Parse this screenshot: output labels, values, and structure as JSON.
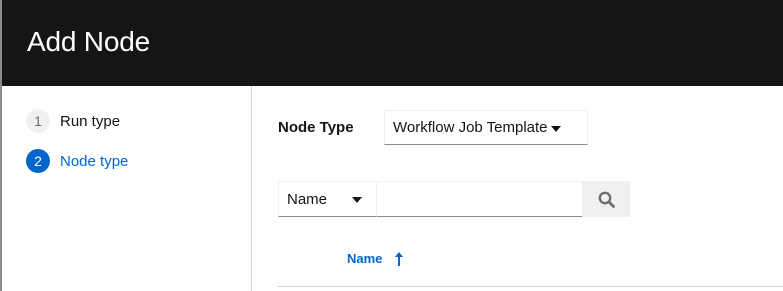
{
  "header": {
    "title": "Add Node"
  },
  "wizard": {
    "steps": [
      {
        "number": "1",
        "label": "Run type",
        "state": "inactive"
      },
      {
        "number": "2",
        "label": "Node type",
        "state": "active"
      }
    ]
  },
  "form": {
    "node_type_label": "Node Type",
    "node_type_value": "Workflow Job Template"
  },
  "toolbar": {
    "filter_field": "Name",
    "search_value": "",
    "search_placeholder": "",
    "search_icon": "search-icon"
  },
  "table": {
    "columns": [
      {
        "label": "Name",
        "sort": "ascending"
      }
    ]
  },
  "colors": {
    "header_bg": "#151515",
    "accent": "#0066cc",
    "muted": "#6a6e73"
  }
}
